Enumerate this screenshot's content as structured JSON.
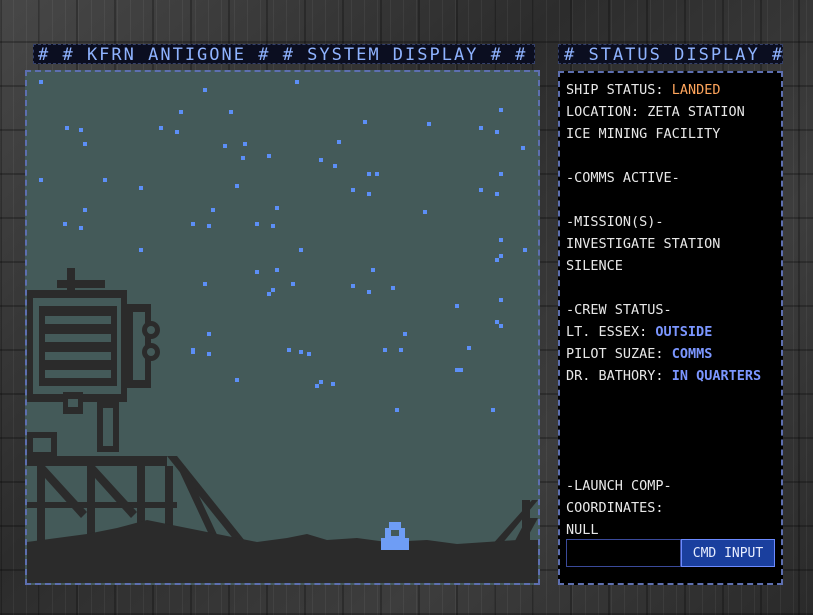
{
  "window": {
    "system_title": "# # KFRN ANTIGONE # # SYSTEM DISPLAY # #",
    "status_title": "# STATUS DISPLAY #"
  },
  "status": {
    "ship_status_label": "SHIP STATUS:",
    "ship_status_value": "LANDED",
    "location_label": "LOCATION: ZETA STATION",
    "location_line2": "ICE MINING FACILITY",
    "comms": "-COMMS ACTIVE-",
    "missions_header": "-MISSION(S)-",
    "mission_line1": "INVESTIGATE STATION",
    "mission_line2": "SILENCE",
    "crew_header": "-CREW STATUS-",
    "crew": [
      {
        "name": "LT. ESSEX:",
        "state": "OUTSIDE"
      },
      {
        "name": "PILOT SUZAE:",
        "state": "COMMS"
      },
      {
        "name": "DR. BATHORY:",
        "state": "IN QUARTERS"
      }
    ],
    "launch_header": "-LAUNCH COMP-",
    "coordinates_label": "COORDINATES:",
    "coordinates_value": "NULL",
    "dashes": "- - -"
  },
  "command": {
    "input_value": "",
    "button_label": "CMD INPUT"
  },
  "colors": {
    "sky": "#445a59",
    "stars": "#5c8ff7",
    "ground": "#2b2b2b",
    "landed": "#ffa55c",
    "crew_state": "#7b96ff"
  }
}
